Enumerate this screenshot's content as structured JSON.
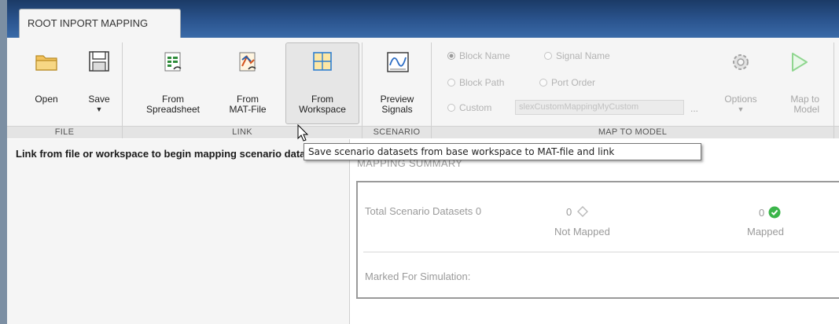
{
  "tab": {
    "label": "ROOT INPORT MAPPING"
  },
  "ribbon": {
    "groups": {
      "file": "FILE",
      "link": "LINK",
      "scenario": "SCENARIO",
      "map_to_model": "MAP TO MODEL"
    },
    "file": {
      "open": "Open",
      "save": "Save"
    },
    "link": {
      "from_spreadsheet_1": "From",
      "from_spreadsheet_2": "Spreadsheet",
      "from_matfile_1": "From",
      "from_matfile_2": "MAT-File",
      "from_workspace_1": "From",
      "from_workspace_2": "Workspace"
    },
    "scenario": {
      "preview_1": "Preview",
      "preview_2": "Signals"
    },
    "map_to_model": {
      "radio_block_name": "Block Name",
      "radio_signal_name": "Signal Name",
      "radio_block_path": "Block Path",
      "radio_port_order": "Port Order",
      "radio_custom": "Custom",
      "custom_value": "slexCustomMappingMyCustom",
      "ellipsis": "...",
      "options": "Options",
      "map_1": "Map to",
      "map_2": "Model"
    }
  },
  "tooltip": "Save scenario datasets from base workspace to MAT-file and link",
  "left_panel": {
    "message": "Link from file or workspace to begin mapping scenario datasets."
  },
  "summary": {
    "title": "MAPPING SUMMARY",
    "total_label": "Total Scenario Datasets 0",
    "not_mapped_count": "0",
    "not_mapped_label": "Not Mapped",
    "mapped_count": "0",
    "mapped_label": "Mapped",
    "marked_label": "Marked For Simulation:"
  },
  "colors": {
    "title_bar": "#2b558f",
    "mapped_check": "#3bb54a",
    "play_icon": "#8fd68f"
  }
}
